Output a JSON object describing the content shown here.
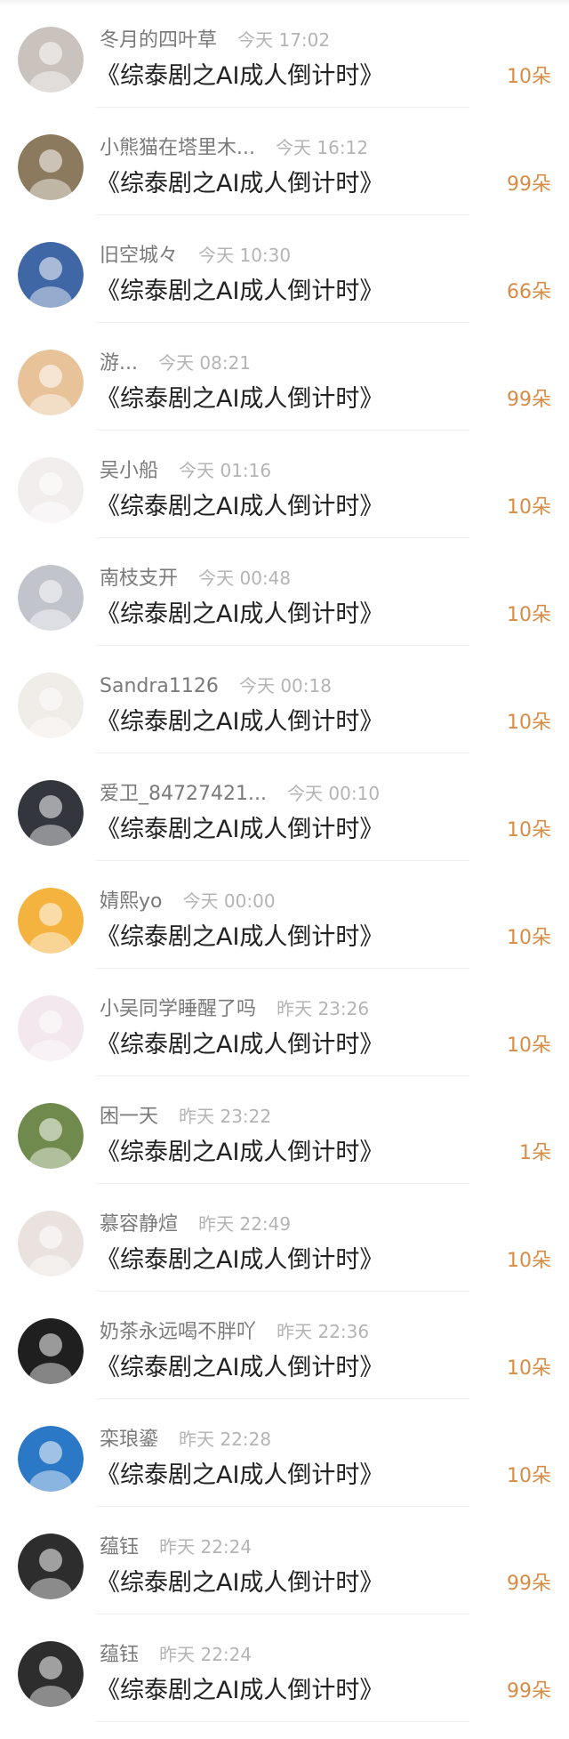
{
  "gifts": [
    {
      "name": "冬月的四叶草",
      "time": "今天 17:02",
      "work": "《综泰剧之AI成人倒计时》",
      "amount": "10朵",
      "avatar_icon": "cat-avatar-icon",
      "avatar_color": "#c9c2bd"
    },
    {
      "name": "小熊猫在塔里木...",
      "time": "今天 16:12",
      "work": "《综泰剧之AI成人倒计时》",
      "amount": "99朵",
      "avatar_icon": "child-avatar-icon",
      "avatar_color": "#8c7a5e"
    },
    {
      "name": "旧空城々",
      "time": "今天 10:30",
      "work": "《综泰剧之AI成人倒计时》",
      "amount": "66朵",
      "avatar_icon": "sea-avatar-icon",
      "avatar_color": "#3f67a6"
    },
    {
      "name": "游...",
      "time": "今天 08:21",
      "work": "《综泰剧之AI成人倒计时》",
      "amount": "99朵",
      "avatar_icon": "girl-avatar-icon",
      "avatar_color": "#e8c39a"
    },
    {
      "name": "吴小船",
      "time": "今天 01:16",
      "work": "《综泰剧之AI成人倒计时》",
      "amount": "10朵",
      "avatar_icon": "cartoon-avatar-icon",
      "avatar_color": "#f3eeee"
    },
    {
      "name": "南枝支开",
      "time": "今天 00:48",
      "work": "《综泰剧之AI成人倒计时》",
      "amount": "10朵",
      "avatar_icon": "man-avatar-icon",
      "avatar_color": "#c2c4cc"
    },
    {
      "name": "Sandra1126",
      "time": "今天 00:18",
      "work": "《综泰剧之AI成人倒计时》",
      "amount": "10朵",
      "avatar_icon": "anime-boy-avatar-icon",
      "avatar_color": "#f0ece8"
    },
    {
      "name": "爱卫_84727421...",
      "time": "今天 00:10",
      "work": "《综泰剧之AI成人倒计时》",
      "amount": "10朵",
      "avatar_icon": "man-avatar-icon",
      "avatar_color": "#33363d"
    },
    {
      "name": "婧熙yo",
      "time": "今天 00:00",
      "work": "《综泰剧之AI成人倒计时》",
      "amount": "10朵",
      "avatar_icon": "dragon-avatar-icon",
      "avatar_color": "#f4b23e"
    },
    {
      "name": "小吴同学睡醒了吗",
      "time": "昨天 23:26",
      "work": "《综泰剧之AI成人倒计时》",
      "amount": "10朵",
      "avatar_icon": "sketch-avatar-icon",
      "avatar_color": "#f2e8ee"
    },
    {
      "name": "困一天",
      "time": "昨天 23:22",
      "work": "《综泰剧之AI成人倒计时》",
      "amount": "1朵",
      "avatar_icon": "tulip-avatar-icon",
      "avatar_color": "#6f8a4c"
    },
    {
      "name": "慕容静煊",
      "time": "昨天 22:49",
      "work": "《综泰剧之AI成人倒计时》",
      "amount": "10朵",
      "avatar_icon": "girl-avatar-icon",
      "avatar_color": "#e9e2df"
    },
    {
      "name": "奶茶永远喝不胖吖",
      "time": "昨天 22:36",
      "work": "《综泰剧之AI成人倒计时》",
      "amount": "10朵",
      "avatar_icon": "black-cat-avatar-icon",
      "avatar_color": "#1f1f1f"
    },
    {
      "name": "栾琅鎏",
      "time": "昨天 22:28",
      "work": "《综泰剧之AI成人倒计时》",
      "amount": "10朵",
      "avatar_icon": "sponge-avatar-icon",
      "avatar_color": "#2a78c6"
    },
    {
      "name": "蕴钰",
      "time": "昨天 22:24",
      "work": "《综泰剧之AI成人倒计时》",
      "amount": "99朵",
      "avatar_icon": "dark-portrait-avatar-icon",
      "avatar_color": "#2d2d2d"
    },
    {
      "name": "蕴钰",
      "time": "昨天 22:24",
      "work": "《综泰剧之AI成人倒计时》",
      "amount": "99朵",
      "avatar_icon": "dark-portrait-avatar-icon",
      "avatar_color": "#2d2d2d"
    }
  ],
  "colors": {
    "amount": "#d78c46",
    "name": "#7a7a7a",
    "time": "#b4b4b4",
    "title": "#222222"
  }
}
